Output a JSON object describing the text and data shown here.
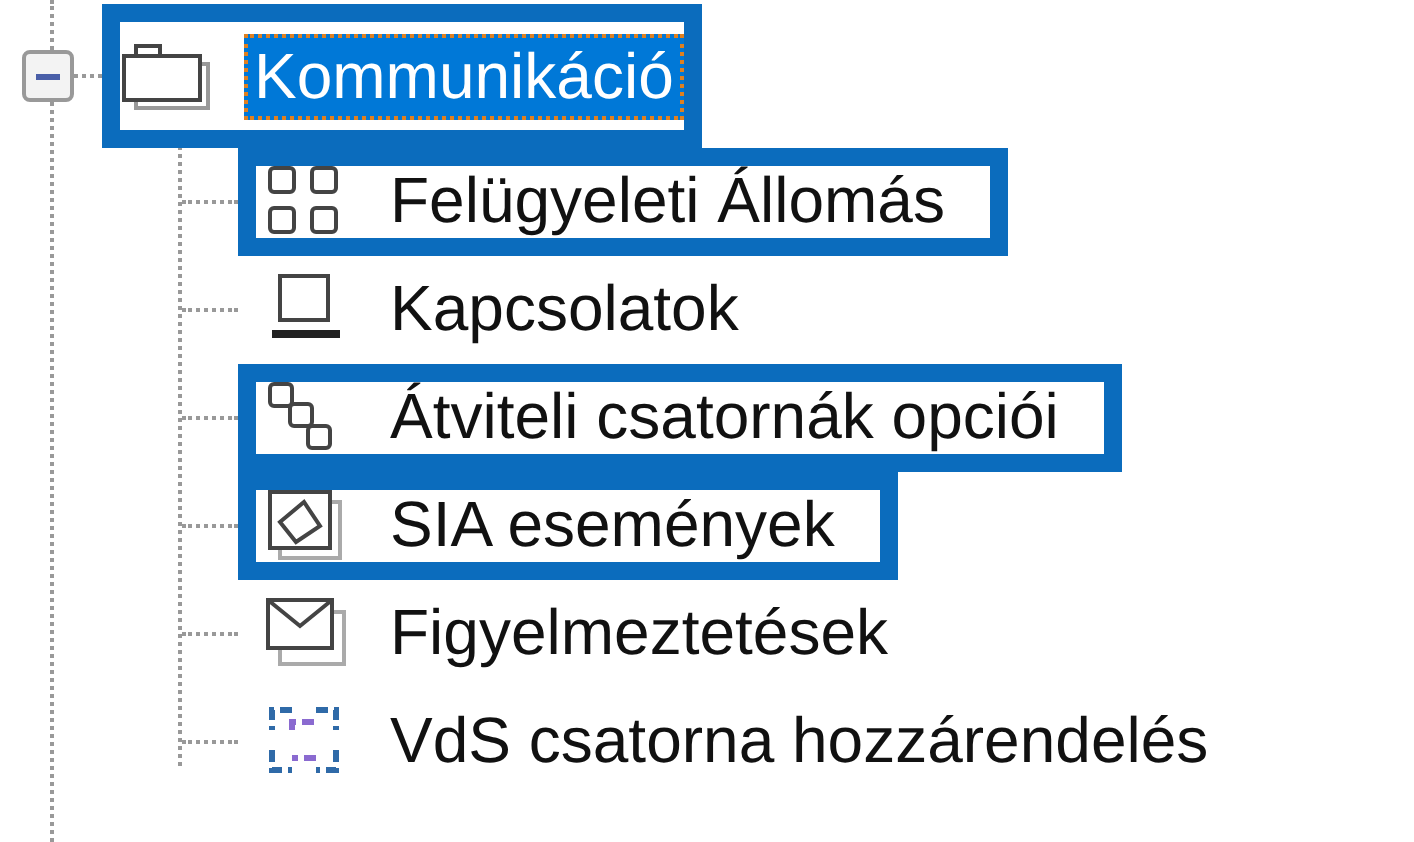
{
  "tree": {
    "label": "Kommunikáció",
    "expanded": true,
    "selected": true,
    "highlighted": true,
    "children": [
      {
        "label": "Felügyeleti Állomás",
        "highlighted": true
      },
      {
        "label": "Kapcsolatok",
        "highlighted": false
      },
      {
        "label": "Átviteli csatornák opciói",
        "highlighted": true
      },
      {
        "label": "SIA események",
        "highlighted": true
      },
      {
        "label": "Figyelmeztetések",
        "highlighted": false
      },
      {
        "label": "VdS csatorna hozzárendelés",
        "highlighted": false
      }
    ]
  }
}
